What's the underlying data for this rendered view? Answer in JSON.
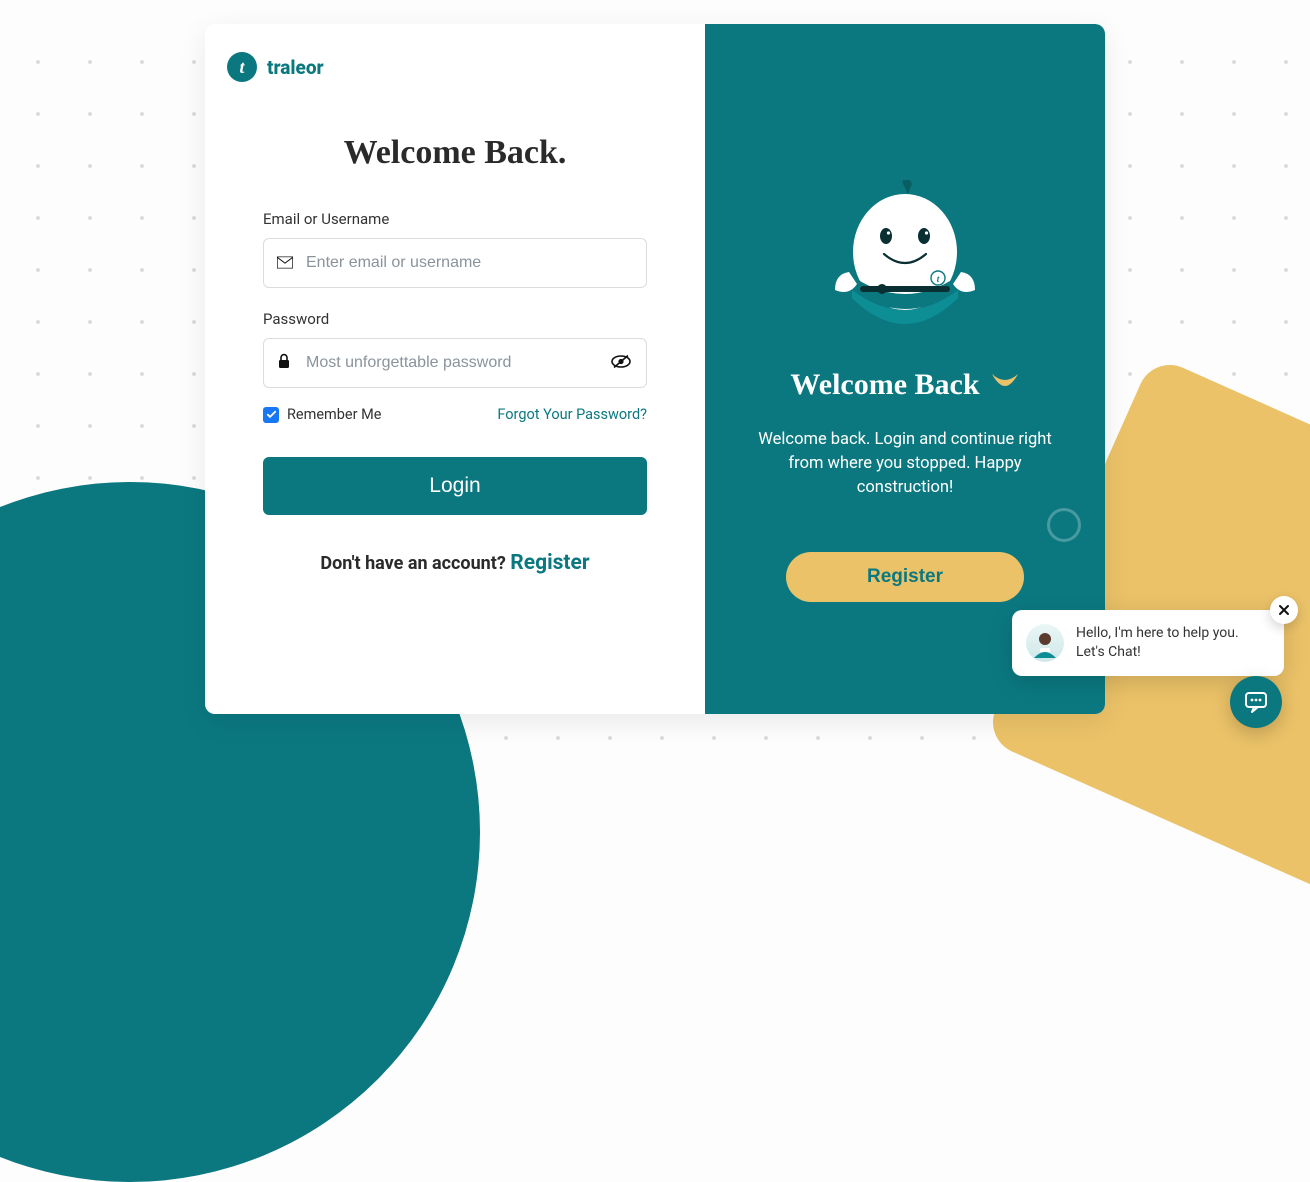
{
  "brand": {
    "name": "traleor",
    "logo_glyph": "t"
  },
  "left": {
    "title": "Welcome Back.",
    "email": {
      "label": "Email or Username",
      "placeholder": "Enter email or username",
      "value": ""
    },
    "password": {
      "label": "Password",
      "placeholder": "Most unforgettable password",
      "value": ""
    },
    "remember": {
      "label": "Remember Me",
      "checked": true
    },
    "forgot_label": "Forgot Your Password?",
    "login_label": "Login",
    "no_account_prefix": "Don't have an account? ",
    "register_label": "Register"
  },
  "right": {
    "title": "Welcome Back",
    "subtitle": "Welcome back. Login and continue right from where you stopped. Happy construction!",
    "register_label": "Register"
  },
  "chat": {
    "message": "Hello, I'm here to help you. Let's Chat!"
  },
  "colors": {
    "teal": "#0b7880",
    "gold": "#ebc268",
    "checkbox_blue": "#1877f2"
  },
  "icons": {
    "email": "email-icon",
    "lock": "lock-icon",
    "eye": "eye-toggle-icon",
    "hug": "hug-emoji-icon",
    "chat": "chat-icon",
    "close": "close-icon",
    "check": "check-icon"
  }
}
